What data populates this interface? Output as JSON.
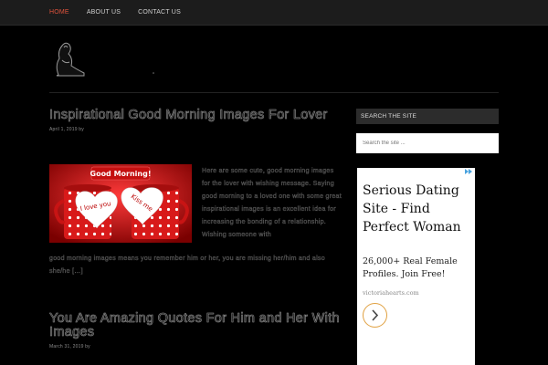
{
  "nav": {
    "items": [
      {
        "label": "HOME"
      },
      {
        "label": "ABOUT US"
      },
      {
        "label": "CONTACT US"
      }
    ]
  },
  "posts": [
    {
      "title": "Inspirational Good Morning Images For Lover",
      "meta": "April 1, 2019 by ",
      "excerpt_right": "Here are some cute, good morning images for the lover with wishing message. Saying good morning to a loved one with some great inspirational images is an excellent idea for increasing the bonding of a relationship. Wishing someone with",
      "excerpt_full": "good morning images means you remember him or her, you are missing her/him and also she/he […]",
      "image": {
        "banner": "Good Morning!",
        "heart_left": "I love you",
        "heart_right": "Kiss me"
      }
    },
    {
      "title": "You Are Amazing Quotes For Him and Her With Images",
      "meta": "March 31, 2019 by "
    }
  ],
  "sidebar": {
    "search_title": "SEARCH THE SITE",
    "search_placeholder": "Search the site ..."
  },
  "ad": {
    "headline": "Serious Dating Site - Find Perfect Woman",
    "body": "26,000+ Real Female Profiles. Join Free!",
    "url": "victoriahearts.com",
    "icon": "chevron-right-icon"
  }
}
